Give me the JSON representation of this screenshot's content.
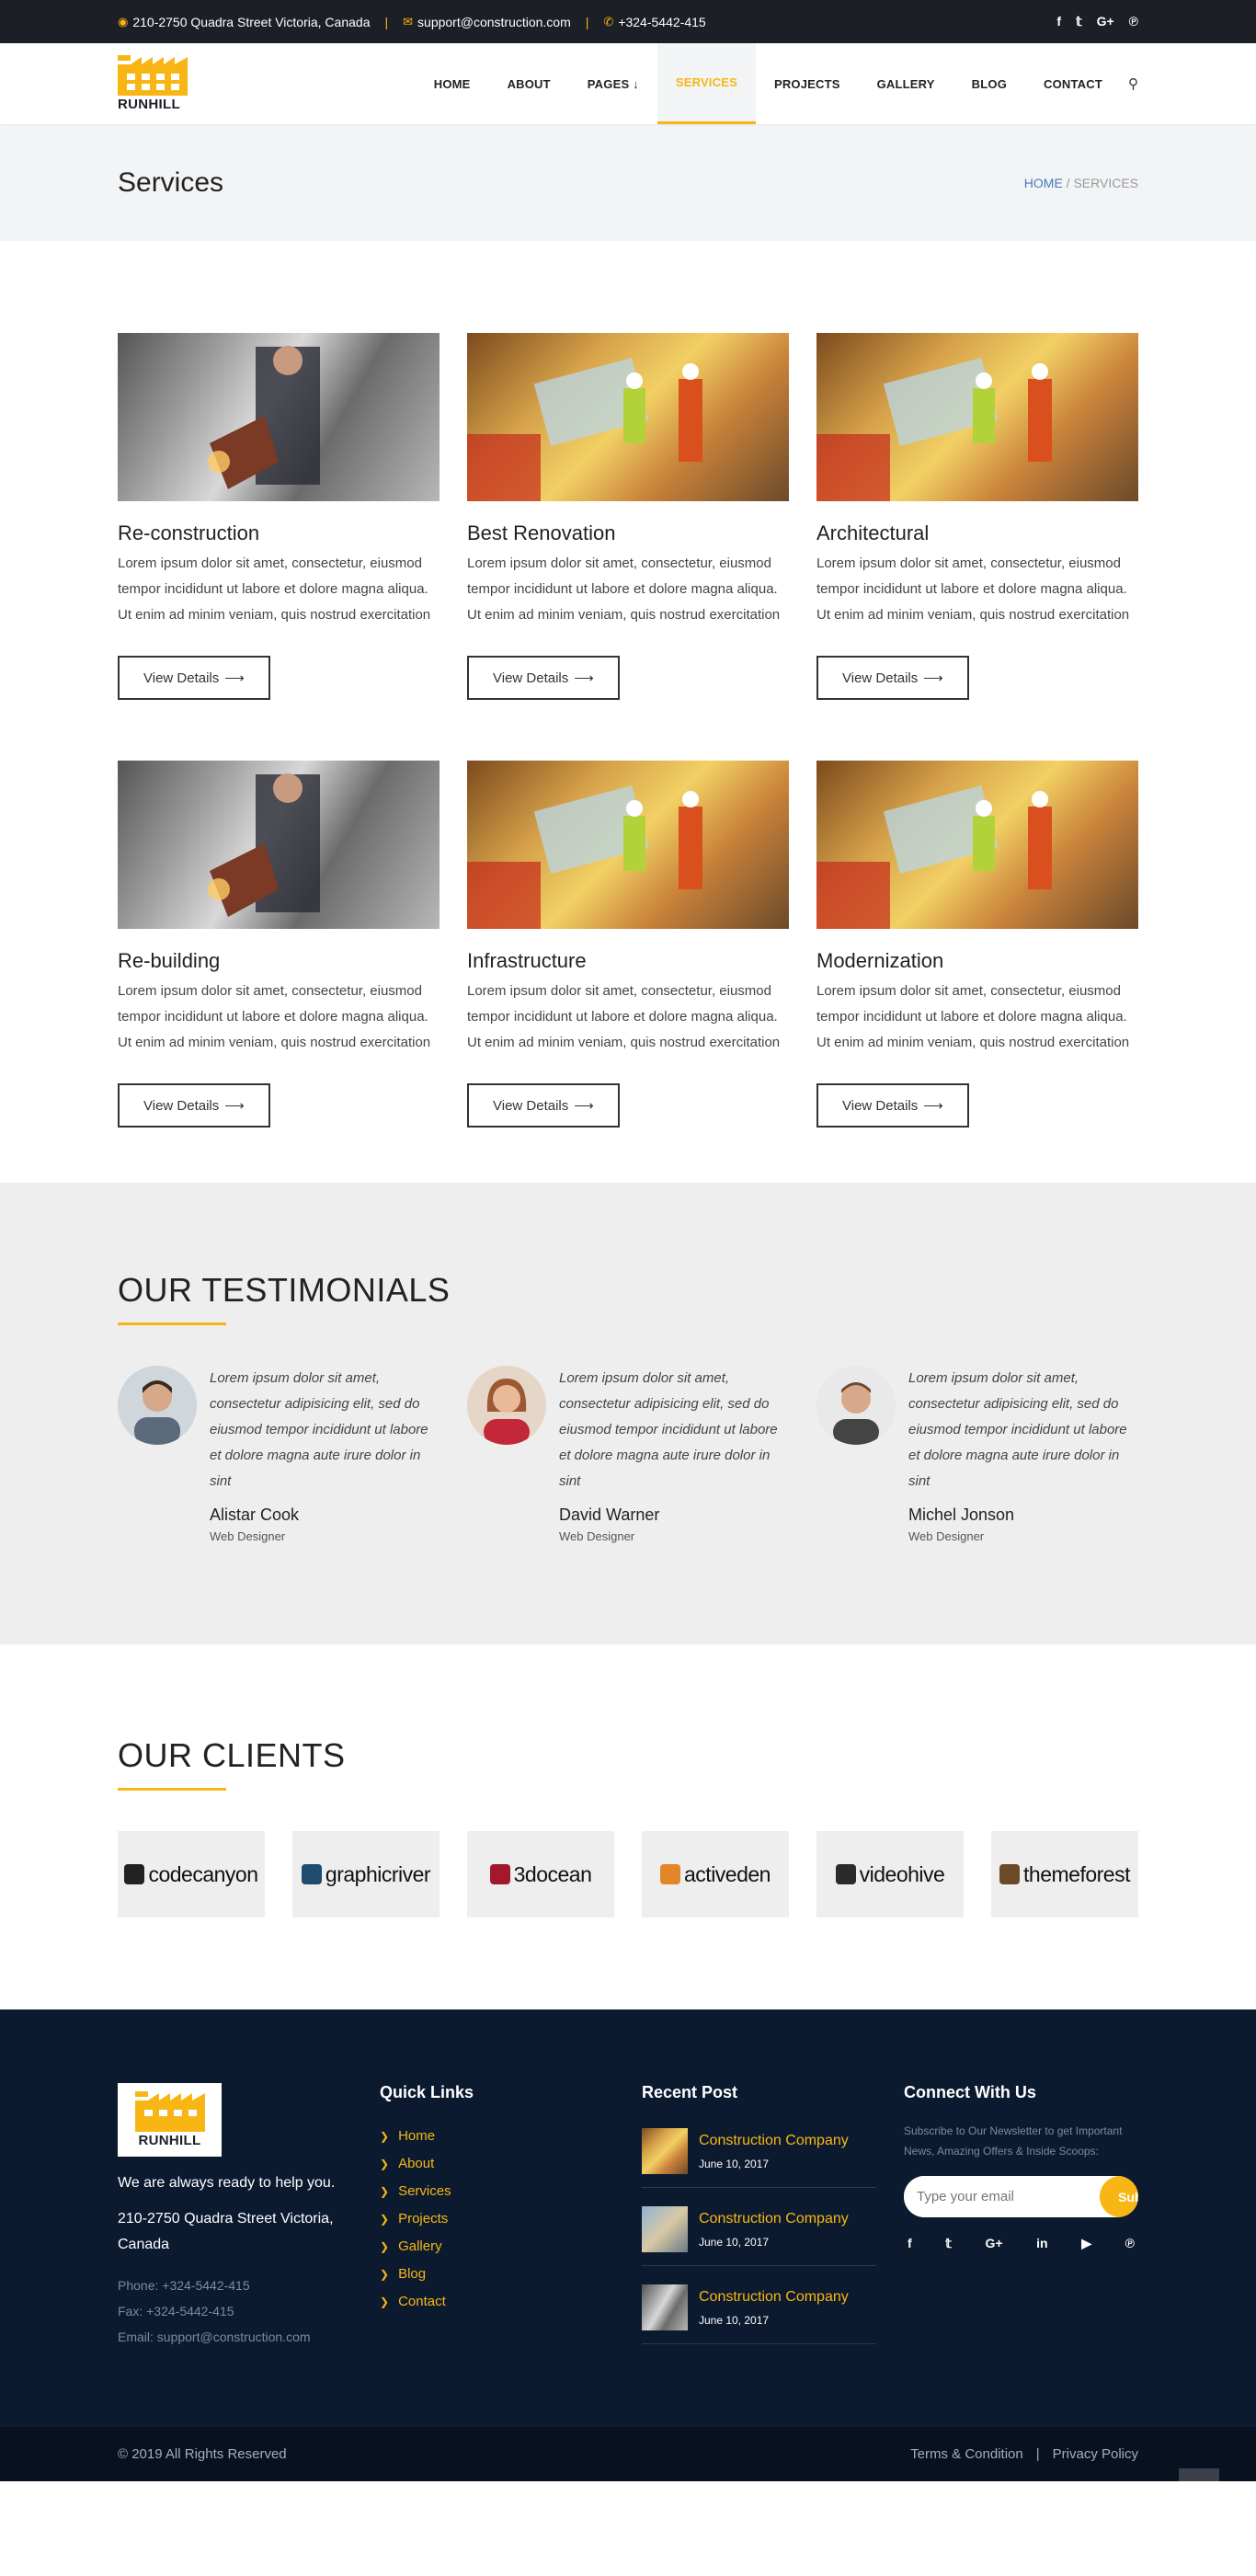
{
  "topbar": {
    "address": "210-2750 Quadra Street Victoria, Canada",
    "email": "support@construction.com",
    "phone": "+324-5442-415",
    "social": [
      "f",
      "𝕥",
      "G+",
      "℗"
    ]
  },
  "brand": {
    "name": "RUNHILL",
    "accent": "#f7b614",
    "dark": "#1c1f26",
    "footer_bg": "#0c1a30"
  },
  "nav": {
    "items": [
      {
        "label": "HOME"
      },
      {
        "label": "ABOUT"
      },
      {
        "label": "PAGES ↓"
      },
      {
        "label": "SERVICES"
      },
      {
        "label": "PROJECTS"
      },
      {
        "label": "GALLERY"
      },
      {
        "label": "BLOG"
      },
      {
        "label": "CONTACT"
      }
    ],
    "active": "SERVICES"
  },
  "page_title": {
    "title": "Services",
    "crumb_home": "HOME",
    "crumb_sep": " / ",
    "crumb_current": "SERVICES"
  },
  "services": {
    "button_label": "View Details",
    "items": [
      {
        "title": "Re-construction",
        "text": "Lorem ipsum dolor sit amet, consectetur, eiusmod tempor incididunt ut labore et dolore magna aliqua. Ut enim ad minim veniam, quis nostrud exercitation",
        "image": "metal-grinding-photo"
      },
      {
        "title": "Best Renovation",
        "text": "Lorem ipsum dolor sit amet, consectetur, eiusmod tempor incididunt ut labore et dolore magna aliqua. Ut enim ad minim veniam, quis nostrud exercitation",
        "image": "construction-site-photo"
      },
      {
        "title": "Architectural",
        "text": "Lorem ipsum dolor sit amet, consectetur, eiusmod tempor incididunt ut labore et dolore magna aliqua. Ut enim ad minim veniam, quis nostrud exercitation",
        "image": "construction-site-photo"
      },
      {
        "title": "Re-building",
        "text": "Lorem ipsum dolor sit amet, consectetur, eiusmod tempor incididunt ut labore et dolore magna aliqua. Ut enim ad minim veniam, quis nostrud exercitation",
        "image": "metal-grinding-photo"
      },
      {
        "title": "Infrastructure",
        "text": "Lorem ipsum dolor sit amet, consectetur, eiusmod tempor incididunt ut labore et dolore magna aliqua. Ut enim ad minim veniam, quis nostrud exercitation",
        "image": "construction-site-photo"
      },
      {
        "title": "Modernization",
        "text": "Lorem ipsum dolor sit amet, consectetur, eiusmod tempor incididunt ut labore et dolore magna aliqua. Ut enim ad minim veniam, quis nostrud exercitation",
        "image": "construction-site-photo"
      }
    ]
  },
  "testimonials": {
    "title": "OUR TESTIMONIALS",
    "items": [
      {
        "quote": "Lorem ipsum dolor sit amet, consectetur adipisicing elit, sed do eiusmod tempor incididunt ut labore et dolore magna aute irure dolor in sint",
        "name": "Alistar Cook",
        "role": "Web Designer"
      },
      {
        "quote": "Lorem ipsum dolor sit amet, consectetur adipisicing elit, sed do eiusmod tempor incididunt ut labore et dolore magna aute irure dolor in sint",
        "name": "David Warner",
        "role": "Web Designer"
      },
      {
        "quote": "Lorem ipsum dolor sit amet, consectetur adipisicing elit, sed do eiusmod tempor incididunt ut labore et dolore magna aute irure dolor in sint",
        "name": "Michel Jonson",
        "role": "Web Designer"
      }
    ]
  },
  "clients": {
    "title": "OUR CLIENTS",
    "items": [
      {
        "name": "codecanyon",
        "color": "#222222"
      },
      {
        "name": "graphicriver",
        "color": "#1f4b6e"
      },
      {
        "name": "3docean",
        "color": "#a3182c"
      },
      {
        "name": "activeden",
        "color": "#e3862a"
      },
      {
        "name": "videohive",
        "color": "#2b2b2b"
      },
      {
        "name": "themeforest",
        "color": "#6b4a2a"
      }
    ]
  },
  "footer": {
    "tagline": "We are always ready to help you.",
    "address": "210-2750 Quadra Street Victoria, Canada",
    "phone": "Phone: +324-5442-415",
    "fax": "Fax: +324-5442-415",
    "email": "Email: support@construction.com",
    "quick_links_title": "Quick Links",
    "quick_links": [
      "Home",
      "About",
      "Services",
      "Projects",
      "Gallery",
      "Blog",
      "Contact"
    ],
    "recent_title": "Recent Post",
    "recent_posts": [
      {
        "title": "Construction Company",
        "date": "June 10, 2017"
      },
      {
        "title": "Construction Company",
        "date": "June 10, 2017"
      },
      {
        "title": "Construction Company",
        "date": "June 10, 2017"
      }
    ],
    "connect_title": "Connect With Us",
    "newsletter_note": "Subscribe to Our Newsletter to get Important News, Amazing Offers & Inside Scoops:",
    "email_placeholder": "Type your email",
    "subscribe_label": "Subscribe",
    "social": [
      "f",
      "𝕥",
      "G+",
      "in",
      "▶",
      "℗"
    ]
  },
  "bottom": {
    "copyright": "© 2019 All Rights Reserved",
    "terms": "Terms & Condition",
    "sep": "|",
    "privacy": "Privacy Policy"
  }
}
